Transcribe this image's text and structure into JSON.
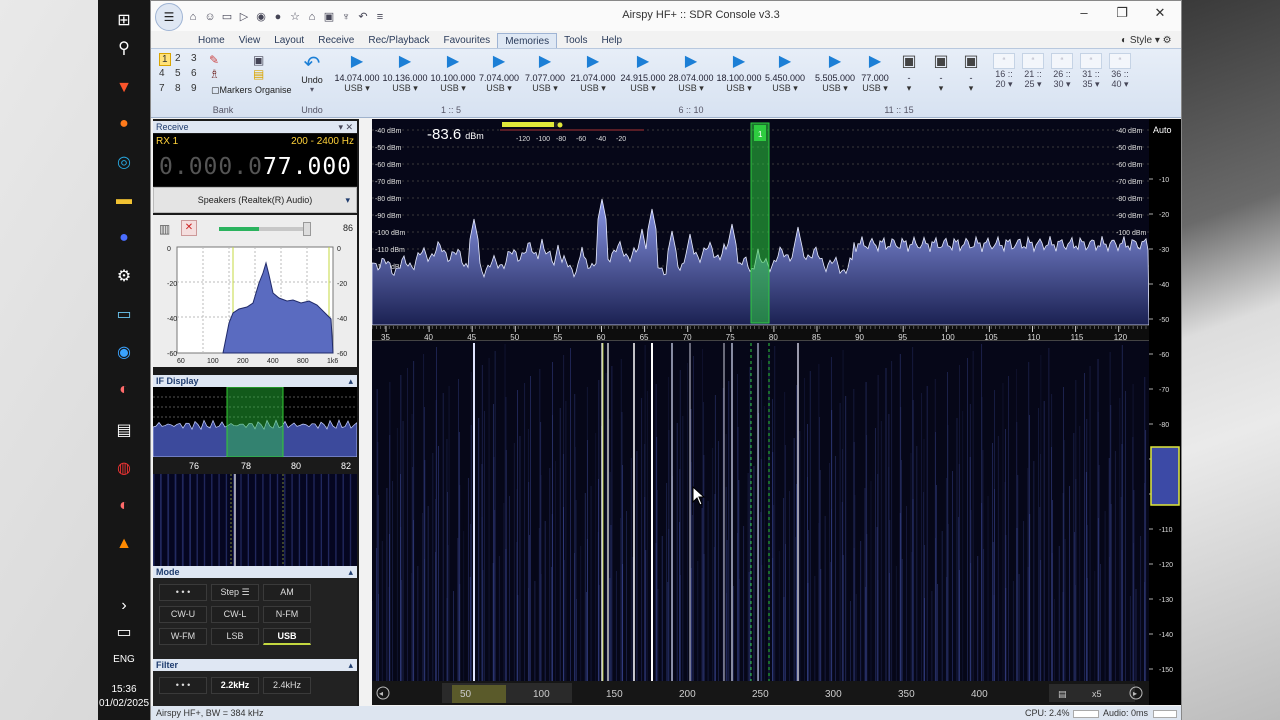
{
  "window": {
    "title": "Airspy HF+ :: SDR Console v3.3",
    "style_label": "Style"
  },
  "menu": {
    "items": [
      "Home",
      "View",
      "Layout",
      "Receive",
      "Rec/Playback",
      "Favourites",
      "Memories",
      "Tools",
      "Help"
    ],
    "active": "Memories"
  },
  "ribbon": {
    "bank_numbers": [
      "1",
      "2",
      "3",
      "4",
      "5",
      "6",
      "7",
      "8",
      "9"
    ],
    "markers_label": "Markers",
    "organise_label": "Organise",
    "bank_group": "Bank",
    "undo_label": "Undo",
    "undo_group": "Undo",
    "memories": [
      {
        "freq": "14.074.000",
        "mode": "USB"
      },
      {
        "freq": "10.136.000",
        "mode": "USB"
      },
      {
        "freq": "10.100.000",
        "mode": "USB"
      },
      {
        "freq": "7.074.000",
        "mode": "USB"
      },
      {
        "freq": "7.077.000",
        "mode": "USB"
      },
      {
        "freq": "21.074.000",
        "mode": "USB"
      },
      {
        "freq": "24.915.000",
        "mode": "USB"
      },
      {
        "freq": "28.074.000",
        "mode": "USB"
      },
      {
        "freq": "18.100.000",
        "mode": "USB"
      },
      {
        "freq": "5.450.000",
        "mode": "USB"
      },
      {
        "freq": "5.505.000",
        "mode": "USB"
      },
      {
        "freq": "77.000",
        "mode": "USB"
      }
    ],
    "empty_slots": [
      "-",
      "-",
      "-"
    ],
    "group_labels": [
      "1 :: 5",
      "6 :: 10",
      "11 :: 15"
    ],
    "quick_slots": [
      {
        "top": "16 ::",
        "bottom": "20"
      },
      {
        "top": "21 ::",
        "bottom": "25"
      },
      {
        "top": "26 ::",
        "bottom": "30"
      },
      {
        "top": "31 ::",
        "bottom": "35"
      },
      {
        "top": "36 ::",
        "bottom": "40"
      }
    ]
  },
  "receive": {
    "panel_title": "Receive",
    "rx_label": "RX 1",
    "bandwidth_range": "200 - 2400 Hz",
    "freq_dim": "0.000.0",
    "freq_bright": "77.000",
    "audio_device": "Speakers (Realtek(R) Audio)",
    "volume": "86",
    "audio_scale_x": [
      "60",
      "100",
      "200",
      "400",
      "800",
      "1k6"
    ],
    "audio_scale_y_left": [
      "0",
      "-20",
      "-40",
      "-60"
    ],
    "audio_scale_y_right": [
      "0",
      "-20",
      "-40",
      "-60"
    ]
  },
  "if_display": {
    "title": "IF Display",
    "scale": [
      "76",
      "78",
      "80",
      "82"
    ]
  },
  "mode": {
    "title": "Mode",
    "buttons": [
      "• • •",
      "Step ☰",
      "AM",
      "CW-U",
      "CW-L",
      "N-FM",
      "W-FM",
      "LSB",
      "USB"
    ],
    "selected": "USB"
  },
  "filter": {
    "title": "Filter",
    "buttons": [
      "• • •",
      "2.2kHz",
      "2.4kHz"
    ]
  },
  "spectrum": {
    "level_readout": "-83.6",
    "level_unit": "dBm",
    "meter_scale": [
      "-120",
      "-100",
      "-80",
      "-60",
      "-40",
      "-20"
    ],
    "db_labels": [
      "-40 dBm",
      "-50 dBm",
      "-60 dBm",
      "-70 dBm",
      "-80 dBm",
      "-90 dBm",
      "-100 dBm",
      "-110 dBm",
      "-120 dBm",
      "-130 dBm",
      "-140 dBm",
      "-150 dBm"
    ],
    "freq_labels": [
      "35",
      "40",
      "45",
      "50",
      "55",
      "60",
      "65",
      "70",
      "75",
      "80",
      "85",
      "90",
      "95",
      "100",
      "105",
      "110",
      "115",
      "120"
    ],
    "marker_label": "1",
    "auto_label": "Auto",
    "right_scale": [
      "-10",
      "-20",
      "-30",
      "-40",
      "-50",
      "-60",
      "-70",
      "-80",
      "-90",
      "-100",
      "-110",
      "-120",
      "-130",
      "-140",
      "-150"
    ]
  },
  "timeline": {
    "labels": [
      "50",
      "100",
      "150",
      "200",
      "250",
      "300",
      "350",
      "400"
    ],
    "zoom": "x5"
  },
  "status": {
    "left": "Airspy HF+, BW = 384 kHz",
    "cpu": "CPU: 2.4%",
    "audio": "Audio: 0ms"
  },
  "taskbar": {
    "lang": "ENG",
    "time": "15:36",
    "date": "01/02/2025"
  },
  "colors": {
    "accent": "#1c7fd6",
    "marker_green": "#2ecc40",
    "rx_yellow": "#ffd23a",
    "waterfall_bg": "#060718"
  }
}
